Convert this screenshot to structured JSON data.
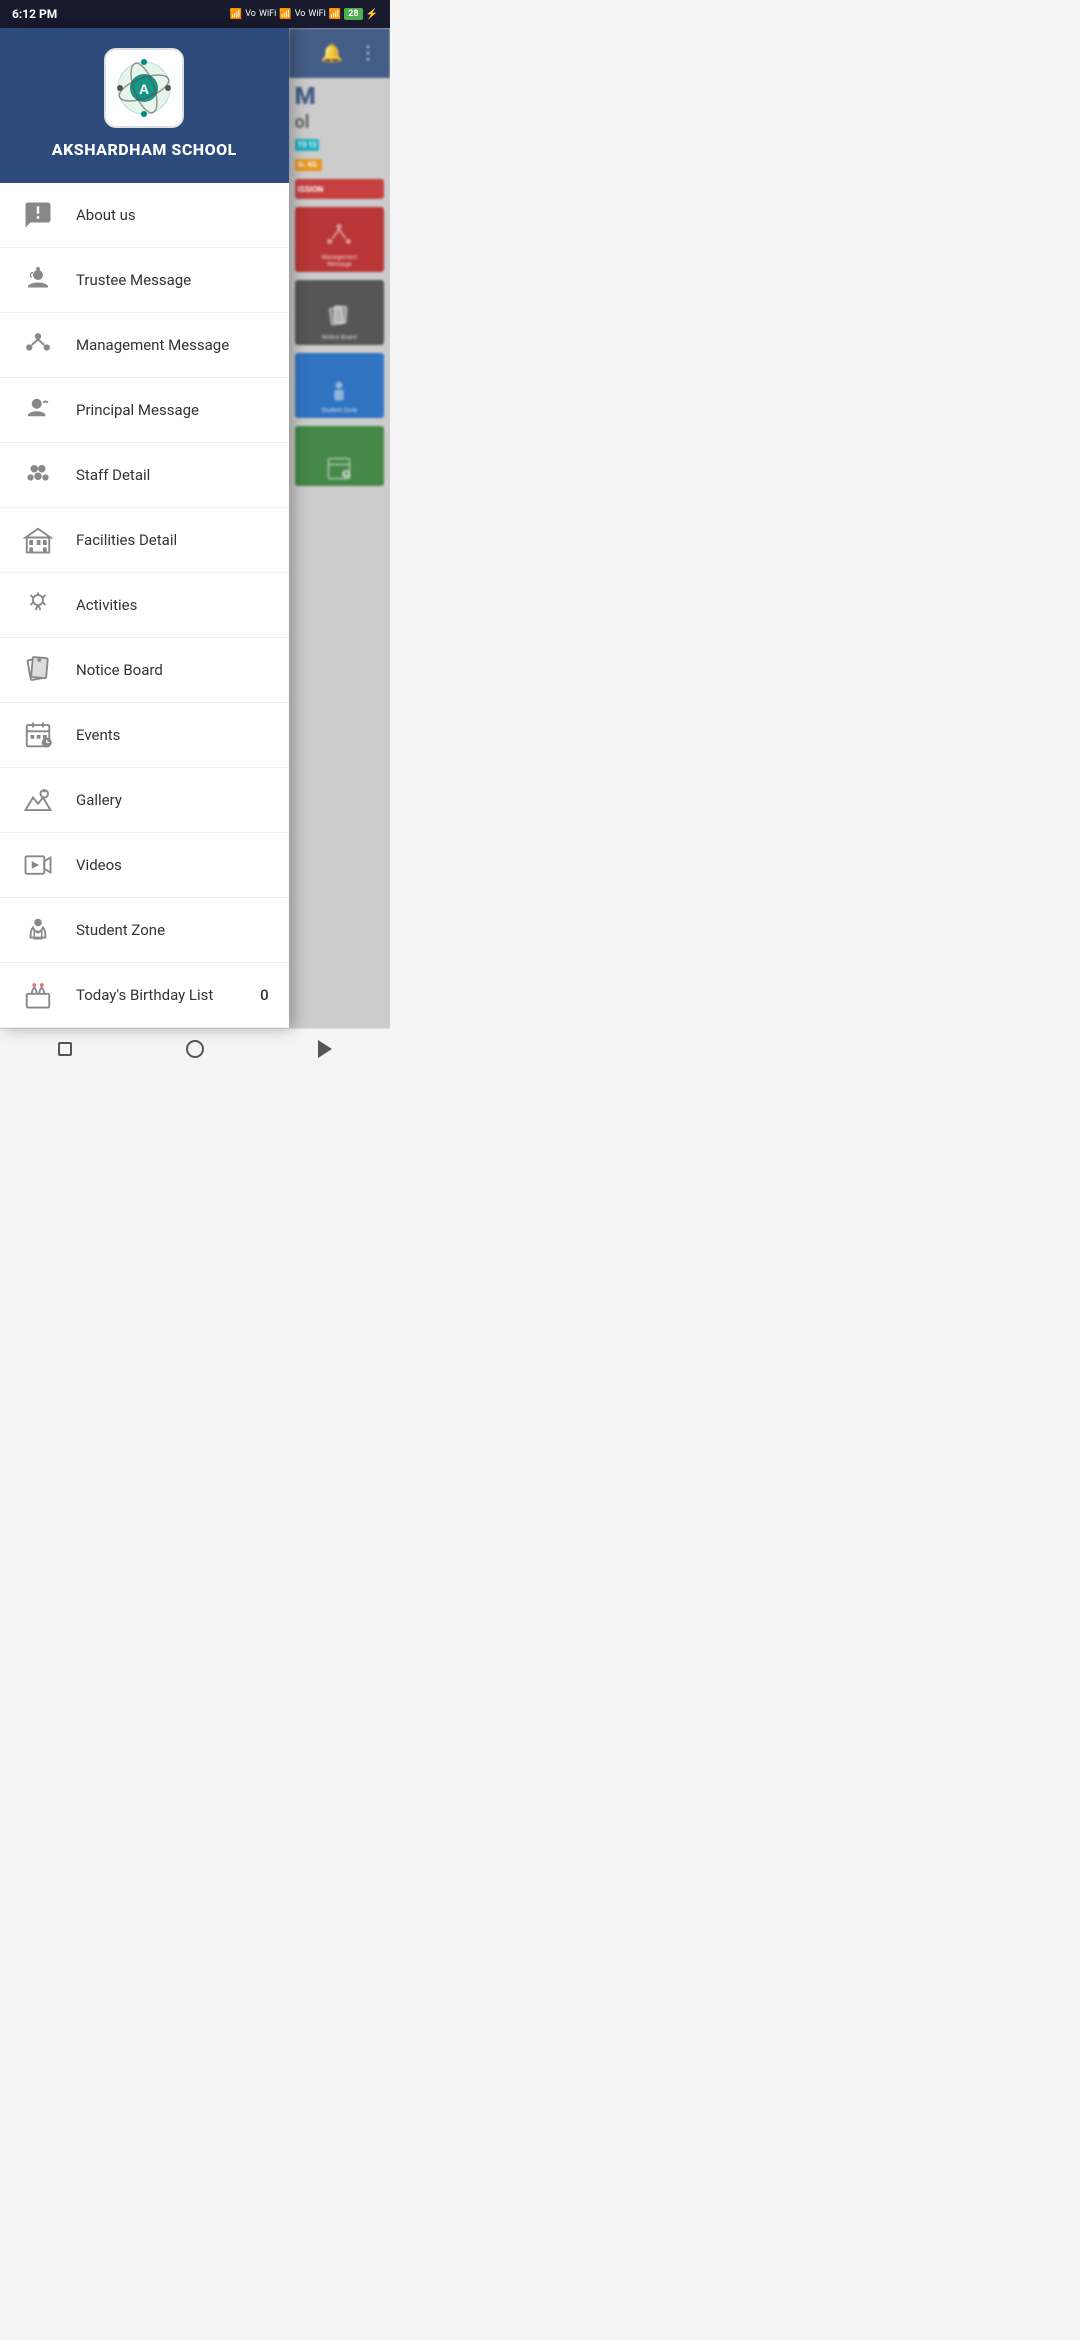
{
  "statusBar": {
    "time": "6:12 PM",
    "battery": "28",
    "icons": [
      "signal",
      "vo-wifi",
      "signal2",
      "vo-wifi2",
      "wifi"
    ]
  },
  "drawer": {
    "schoolName": "AKSHARDHAM SCHOOL",
    "menuItems": [
      {
        "id": "about-us",
        "label": "About us",
        "icon": "info-chat"
      },
      {
        "id": "trustee-message",
        "label": "Trustee Message",
        "icon": "trustee"
      },
      {
        "id": "management-message",
        "label": "Management Message",
        "icon": "management"
      },
      {
        "id": "principal-message",
        "label": "Principal Message",
        "icon": "principal"
      },
      {
        "id": "staff-detail",
        "label": "Staff Detail",
        "icon": "staff"
      },
      {
        "id": "facilities-detail",
        "label": "Facilities Detail",
        "icon": "facilities"
      },
      {
        "id": "activities",
        "label": "Activities",
        "icon": "activities"
      },
      {
        "id": "notice-board",
        "label": "Notice Board",
        "icon": "notice"
      },
      {
        "id": "events",
        "label": "Events",
        "icon": "events"
      },
      {
        "id": "gallery",
        "label": "Gallery",
        "icon": "gallery"
      },
      {
        "id": "videos",
        "label": "Videos",
        "icon": "videos"
      },
      {
        "id": "student-zone",
        "label": "Student Zone",
        "icon": "student-zone"
      },
      {
        "id": "birthday-list",
        "label": "Today's Birthday List",
        "icon": "birthday",
        "badge": "0"
      }
    ]
  },
  "rightPanel": {
    "topBarIcons": [
      "bell-icon",
      "more-icon"
    ],
    "mainTitle": "M",
    "subTitle": "ol",
    "badges": [
      {
        "label": "TO 12",
        "color": "#00acc1"
      },
      {
        "label": "Sr. KG.",
        "color": "#ef8c00"
      }
    ],
    "tiles": [
      {
        "label": "Management\nMessage",
        "color": "#b71c1c"
      },
      {
        "label": "Notice Board",
        "color": "#424242"
      },
      {
        "label": "Student Zone",
        "color": "#1565c0"
      },
      {
        "label": "",
        "color": "#2e7d32"
      }
    ]
  },
  "navBar": {
    "buttons": [
      "square-nav",
      "circle-nav",
      "back-nav"
    ]
  }
}
